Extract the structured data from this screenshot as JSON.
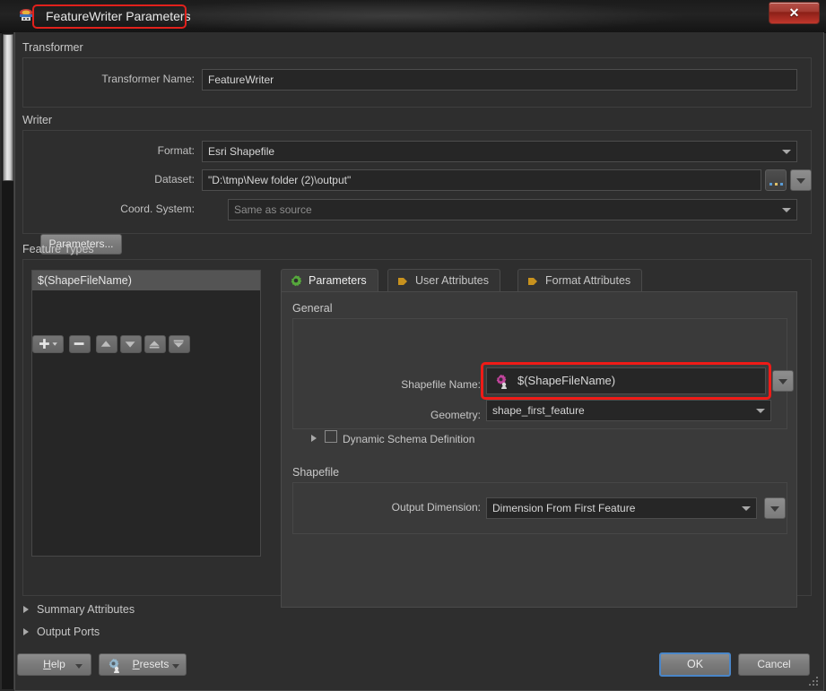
{
  "window": {
    "title": "FeatureWriter Parameters",
    "app_icon": "fme-transformer-icon",
    "close_label": "✕"
  },
  "transformer": {
    "group_label": "Transformer",
    "name_label": "Transformer Name:",
    "name_value": "FeatureWriter"
  },
  "writer": {
    "group_label": "Writer",
    "format_label": "Format:",
    "format_value": "Esri Shapefile",
    "dataset_label": "Dataset:",
    "dataset_value": "\"D:\\tmp\\New folder (2)\\output\"",
    "browse_label": "...",
    "coord_label": "Coord. System:",
    "coord_placeholder": "Same as source",
    "parameters_button": "Parameters..."
  },
  "feature_types": {
    "group_label": "Feature Types",
    "items": [
      {
        "label": "$(ShapeFileName)",
        "selected": true
      }
    ],
    "toolbar": [
      {
        "name": "add-feature-type-button",
        "glyph": "+",
        "has_menu": true
      },
      {
        "name": "remove-feature-type-button",
        "glyph": "−",
        "has_menu": false
      },
      {
        "name": "move-up-button",
        "glyph": "▲",
        "has_menu": false
      },
      {
        "name": "move-down-button",
        "glyph": "▼",
        "has_menu": false
      },
      {
        "name": "move-to-top-button",
        "glyph": "⤒",
        "has_menu": false
      },
      {
        "name": "move-to-bottom-button",
        "glyph": "⤓",
        "has_menu": false
      }
    ]
  },
  "tabs": [
    {
      "label": "Parameters",
      "icon": "green-gear-icon",
      "active": true
    },
    {
      "label": "User Attributes",
      "icon": "orange-arrow-icon",
      "active": false
    },
    {
      "label": "Format Attributes",
      "icon": "orange-arrow-icon",
      "active": false
    }
  ],
  "parameters_tab": {
    "general": {
      "section_label": "General",
      "shapefile_name_label": "Shapefile Name:",
      "shapefile_name_value": "$(ShapeFileName)",
      "shapefile_name_icon": "user-parameter-gear-icon",
      "geometry_label": "Geometry:",
      "geometry_value": "shape_first_feature",
      "dynamic_schema_label": "Dynamic Schema Definition",
      "dynamic_schema_checked": false
    },
    "shapefile": {
      "section_label": "Shapefile",
      "output_dimension_label": "Output Dimension:",
      "output_dimension_value": "Dimension From First Feature"
    }
  },
  "collapsed_sections": [
    {
      "label": "Summary Attributes"
    },
    {
      "label": "Output Ports"
    }
  ],
  "footer": {
    "help_label": "Help",
    "help_mnemonic": "H",
    "presets_label": "Presets",
    "presets_mnemonic": "P",
    "presets_icon": "gear-person-icon",
    "ok_label": "OK",
    "cancel_label": "Cancel"
  },
  "colors": {
    "highlight_red": "#ef1b17",
    "focus_blue": "#4a86c8",
    "tab_gear_green": "#56a83c",
    "tab_arrow_orange": "#c8921e",
    "param_icon_magenta": "#c2449c"
  }
}
